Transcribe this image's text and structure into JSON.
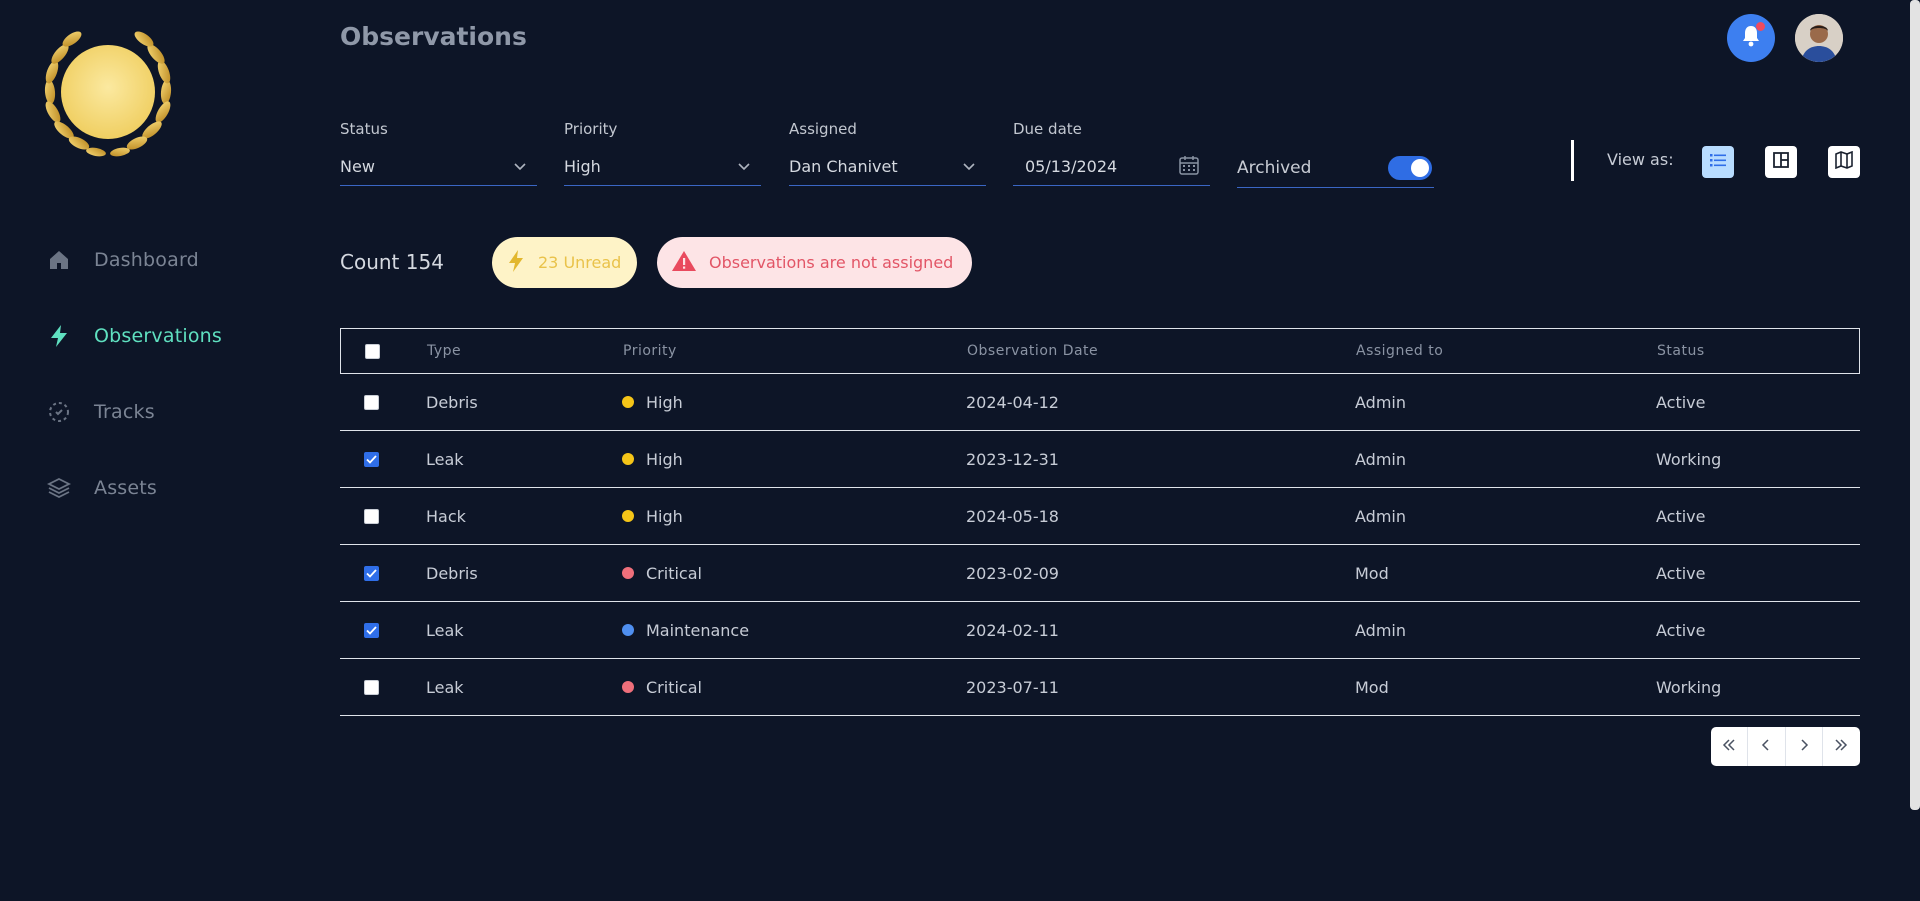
{
  "header": {
    "title": "Observations"
  },
  "sidebar": {
    "items": [
      {
        "label": "Dashboard",
        "icon": "home-icon",
        "active": false
      },
      {
        "label": "Observations",
        "icon": "lightning-icon",
        "active": true
      },
      {
        "label": "Tracks",
        "icon": "tracks-icon",
        "active": false
      },
      {
        "label": "Assets",
        "icon": "layers-icon",
        "active": false
      }
    ]
  },
  "filters": {
    "status": {
      "label": "Status",
      "value": "New"
    },
    "priority": {
      "label": "Priority",
      "value": "High"
    },
    "assigned": {
      "label": "Assigned",
      "value": "Dan Chanivet"
    },
    "due_date": {
      "label": "Due date",
      "value": "05/13/2024"
    },
    "archived": {
      "label": "Archived",
      "on": true
    }
  },
  "view_as": {
    "label": "View as:",
    "options": [
      "list-view-icon",
      "board-view-icon",
      "map-view-icon"
    ],
    "selected": "list-view-icon"
  },
  "summary": {
    "count_text": "Count 154",
    "unread_text": "23 Unread",
    "alert_text": "Observations are not assigned"
  },
  "table": {
    "columns": [
      "Type",
      "Priority",
      "Observation Date",
      "Assigned to",
      "Status"
    ],
    "rows": [
      {
        "checked": false,
        "type": "Debris",
        "priority": "High",
        "date": "2024-04-12",
        "assigned": "Admin",
        "status": "Active"
      },
      {
        "checked": true,
        "type": "Leak",
        "priority": "High",
        "date": "2023-12-31",
        "assigned": "Admin",
        "status": "Working"
      },
      {
        "checked": false,
        "type": "Hack",
        "priority": "High",
        "date": "2024-05-18",
        "assigned": "Admin",
        "status": "Active"
      },
      {
        "checked": true,
        "type": "Debris",
        "priority": "Critical",
        "date": "2023-02-09",
        "assigned": "Mod",
        "status": "Active"
      },
      {
        "checked": true,
        "type": "Leak",
        "priority": "Maintenance",
        "date": "2024-02-11",
        "assigned": "Admin",
        "status": "Active"
      },
      {
        "checked": false,
        "type": "Leak",
        "priority": "Critical",
        "date": "2023-07-11",
        "assigned": "Mod",
        "status": "Working"
      }
    ]
  },
  "priority_colors": {
    "High": "#f5c518",
    "Critical": "#ef6f7b",
    "Maintenance": "#4f8ff0"
  },
  "colors": {
    "background": "#0d1527",
    "accent": "#5fe0c0",
    "primary": "#2f6ee8"
  }
}
